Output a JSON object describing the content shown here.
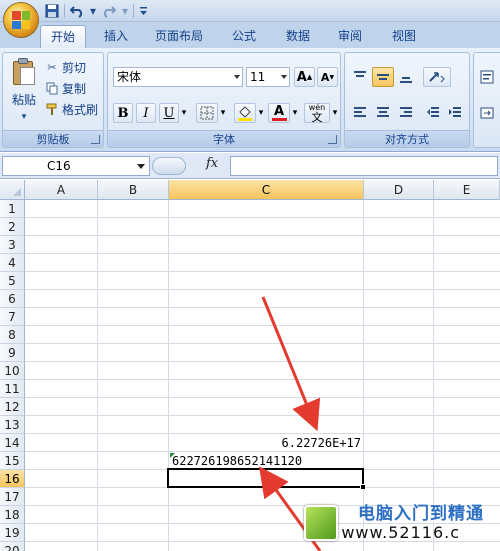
{
  "colors": {
    "accent": "#15428b",
    "selection": "#f7c45c",
    "arrow": "#e53a30",
    "check_mark": "#2e8b3a"
  },
  "tabs": [
    {
      "label": "开始",
      "active": true
    },
    {
      "label": "插入",
      "active": false
    },
    {
      "label": "页面布局",
      "active": false
    },
    {
      "label": "公式",
      "active": false
    },
    {
      "label": "数据",
      "active": false
    },
    {
      "label": "审阅",
      "active": false
    },
    {
      "label": "视图",
      "active": false
    }
  ],
  "quick_access": {
    "icons": [
      "save-icon",
      "undo-icon",
      "redo-icon",
      "customize-icon"
    ]
  },
  "clipboard": {
    "group_label": "剪贴板",
    "paste_label": "粘贴",
    "cut_label": "剪切",
    "copy_label": "复制",
    "format_painter_label": "格式刷"
  },
  "font": {
    "group_label": "字体",
    "font_name": "宋体",
    "font_size": "11",
    "bold": "B",
    "italic": "I",
    "underline": "U",
    "font_color_label": "A",
    "phonetic_label": "wén",
    "phonetic_char": "文"
  },
  "alignment": {
    "group_label": "对齐方式"
  },
  "formula_bar": {
    "name_box": "C16",
    "fx_label": "fx",
    "formula": ""
  },
  "columns": [
    {
      "label": "A",
      "selected": false
    },
    {
      "label": "B",
      "selected": false
    },
    {
      "label": "C",
      "selected": true
    },
    {
      "label": "D",
      "selected": false
    },
    {
      "label": "E",
      "selected": false
    }
  ],
  "rows": [
    "1",
    "2",
    "3",
    "4",
    "5",
    "6",
    "7",
    "8",
    "9",
    "10",
    "11",
    "12",
    "13",
    "14",
    "15",
    "16",
    "17",
    "18",
    "19",
    "20"
  ],
  "selected_row": "16",
  "cells": {
    "C14": "6.22726E+17",
    "C15": "622726198652141120"
  },
  "watermark": {
    "title": "电脑入门到精通",
    "url": "www.52116.c"
  }
}
